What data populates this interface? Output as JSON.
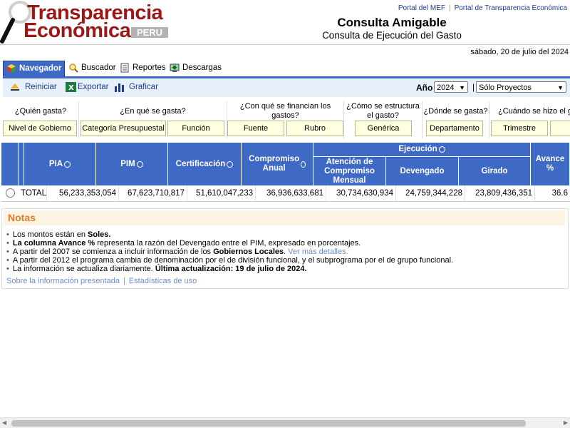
{
  "header": {
    "logo_line1": "Transparencia",
    "logo_line2": "Económica",
    "logo_badge": "PERU",
    "links": [
      "Portal del MEF",
      "Portal de Transparencia Económica"
    ],
    "title": "Consulta Amigable",
    "subtitle": "Consulta de Ejecución del Gasto",
    "date": "sábado, 20 de julio del 2024"
  },
  "tabs": [
    {
      "label": "Navegador",
      "icon": "cube-icon",
      "active": true
    },
    {
      "label": "Buscador",
      "icon": "magnifier-icon"
    },
    {
      "label": "Reportes",
      "icon": "document-icon"
    },
    {
      "label": "Descargas",
      "icon": "download-icon"
    }
  ],
  "toolbar": {
    "reiniciar": "Reiniciar",
    "exportar": "Exportar",
    "graficar": "Graficar",
    "ano_label": "Año",
    "ano_value": "2024",
    "filter_value": "Sólo Proyectos"
  },
  "questions": [
    {
      "q": "¿Quién gasta?",
      "buttons": [
        "Nivel de Gobierno"
      ]
    },
    {
      "q": "¿En qué se gasta?",
      "buttons": [
        "Categoría Presupuestal",
        "Función"
      ]
    },
    {
      "q": "¿Con qué se financian los gastos?",
      "buttons": [
        "Fuente",
        "Rubro"
      ]
    },
    {
      "q": "¿Cómo se estructura el gasto?",
      "buttons": [
        "Genérica"
      ]
    },
    {
      "q": "¿Dónde se gasta?",
      "buttons": [
        "Departamento"
      ]
    },
    {
      "q": "¿Cuándo se hizo el gasto?",
      "buttons": [
        "Trimestre",
        ""
      ]
    }
  ],
  "table": {
    "headers": {
      "pia": "PIA",
      "pim": "PIM",
      "certificacion": "Certificación",
      "compromiso": "Compromiso Anual",
      "ejecucion": "Ejecución",
      "atencion": "Atención de Compromiso Mensual",
      "devengado": "Devengado",
      "girado": "Girado",
      "avance": "Avance %"
    },
    "row": {
      "label": "TOTAL",
      "pia": "56,233,353,054",
      "pim": "67,623,710,817",
      "certificacion": "51,610,047,233",
      "compromiso": "36,936,633,681",
      "atencion": "30,734,630,934",
      "devengado": "24,759,344,228",
      "girado": "23,809,436,351",
      "avance": "36.6"
    }
  },
  "notes": {
    "title": "Notas",
    "n1_a": "Los montos están en ",
    "n1_b": "Soles.",
    "n2_a": "La columna Avance %",
    "n2_b": " representa la razón del Devengado entre el PIM, expresado en porcentajes.",
    "n3_a": "A partir del 2007 se comienza a incluir información de los ",
    "n3_b": "Gobiernos Locales",
    "n3_c": ". ",
    "n3_link": "Ver más detalles.",
    "n4": "A partir del 2012 el programa cambia de denominación por el de división funcional, y el subprograma por el de grupo funcional.",
    "n5_a": "La información se actualiza diariamente. ",
    "n5_b": "Última actualización: 19 de julio de 2024.",
    "link1": "Sobre la información presentada",
    "link2": "Estadísticas de uso"
  }
}
